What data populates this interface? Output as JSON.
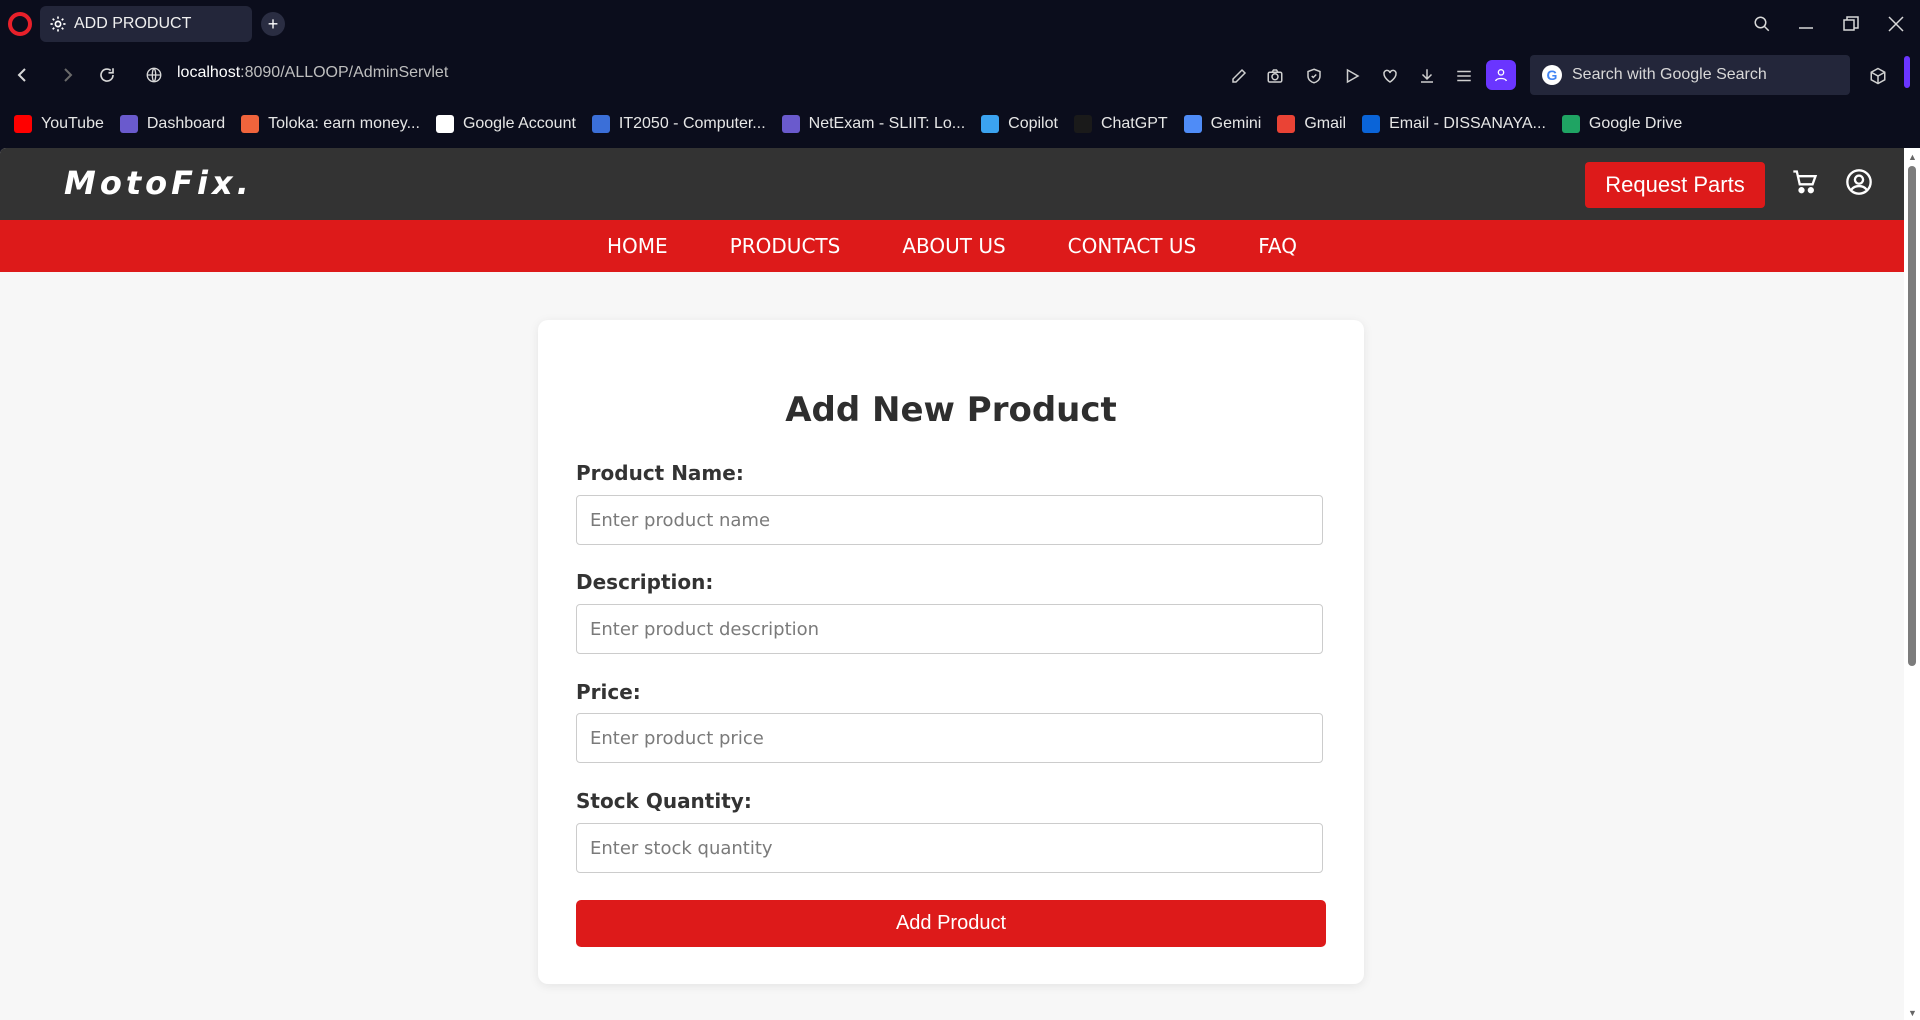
{
  "browser": {
    "tab_title": "ADD PRODUCT",
    "url_host": "localhost",
    "url_rest": ":8090/ALLOOP/AdminServlet",
    "search_placeholder": "Search with Google Search",
    "bookmarks": [
      {
        "label": "YouTube",
        "icon": "youtube-icon",
        "color": "#ff0000"
      },
      {
        "label": "Dashboard",
        "icon": "dashboard-icon",
        "color": "#6a5acd"
      },
      {
        "label": "Toloka: earn money...",
        "icon": "toloka-icon",
        "color": "#f0643c"
      },
      {
        "label": "Google Account",
        "icon": "google-icon",
        "color": "#ffffff"
      },
      {
        "label": "IT2050 - Computer...",
        "icon": "it2050-icon",
        "color": "#3b6fd8"
      },
      {
        "label": "NetExam - SLIIT: Lo...",
        "icon": "netexam-icon",
        "color": "#6a5acd"
      },
      {
        "label": "Copilot",
        "icon": "copilot-icon",
        "color": "#3ba3f0"
      },
      {
        "label": "ChatGPT",
        "icon": "chatgpt-icon",
        "color": "#1a1a1a"
      },
      {
        "label": "Gemini",
        "icon": "gemini-icon",
        "color": "#4f8cf7"
      },
      {
        "label": "Gmail",
        "icon": "gmail-icon",
        "color": "#ea4335"
      },
      {
        "label": "Email - DISSANAYA...",
        "icon": "outlook-icon",
        "color": "#0a64d8"
      },
      {
        "label": "Google Drive",
        "icon": "google-drive-icon",
        "color": "#1fa463"
      }
    ]
  },
  "site": {
    "brand": "MotoFix.",
    "request_button": "Request Parts",
    "nav": [
      "HOME",
      "PRODUCTS",
      "ABOUT US",
      "CONTACT US",
      "FAQ"
    ],
    "colors": {
      "accent": "#dd1a1a",
      "header": "#333333"
    }
  },
  "form": {
    "title": "Add New Product",
    "fields": [
      {
        "label": "Product Name:",
        "placeholder": "Enter product name",
        "value": ""
      },
      {
        "label": "Description:",
        "placeholder": "Enter product description",
        "value": ""
      },
      {
        "label": "Price:",
        "placeholder": "Enter product price",
        "value": ""
      },
      {
        "label": "Stock Quantity:",
        "placeholder": "Enter stock quantity",
        "value": ""
      }
    ],
    "submit_label": "Add Product"
  }
}
